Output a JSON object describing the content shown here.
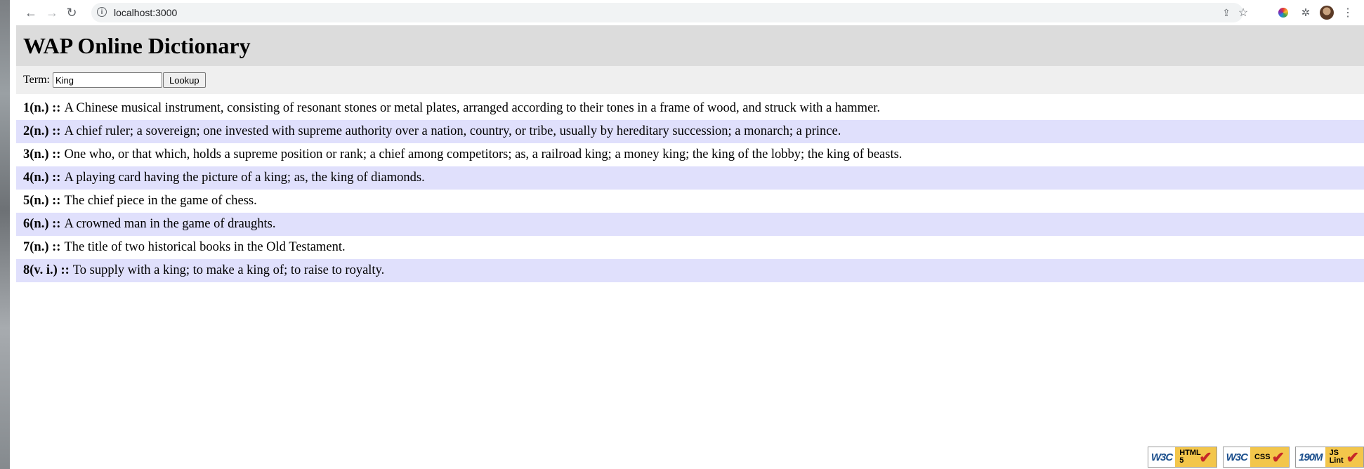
{
  "browser": {
    "url": "localhost:3000"
  },
  "header": {
    "title": "WAP Online Dictionary"
  },
  "search": {
    "label": "Term:",
    "value": "King",
    "button_label": "Lookup"
  },
  "entries": [
    {
      "head": "1(n.) ::",
      "text": "A Chinese musical instrument, consisting of resonant stones or metal plates, arranged according to their tones in a frame of wood, and struck with a hammer."
    },
    {
      "head": "2(n.) ::",
      "text": "A chief ruler; a sovereign; one invested with supreme authority over a nation, country, or tribe, usually by hereditary succession; a monarch; a prince."
    },
    {
      "head": "3(n.) ::",
      "text": "One who, or that which, holds a supreme position or rank; a chief among competitors; as, a railroad king; a money king; the king of the lobby; the king of beasts."
    },
    {
      "head": "4(n.) ::",
      "text": "A playing card having the picture of a king; as, the king of diamonds."
    },
    {
      "head": "5(n.) ::",
      "text": "The chief piece in the game of chess."
    },
    {
      "head": "6(n.) ::",
      "text": "A crowned man in the game of draughts."
    },
    {
      "head": "7(n.) ::",
      "text": "The title of two historical books in the Old Testament."
    },
    {
      "head": "8(v. i.) ::",
      "text": "To supply with a king; to make a king of; to raise to royalty."
    }
  ],
  "badges": [
    {
      "logo": "W3C",
      "tag": "HTML 5"
    },
    {
      "logo": "W3C",
      "tag": "CSS"
    },
    {
      "logo": "190M",
      "tag": "JS Lint"
    }
  ],
  "colors": {
    "header_bg": "#dcdcdc",
    "search_bg": "#efefef",
    "alt_row_bg": "#e0e0fc"
  }
}
